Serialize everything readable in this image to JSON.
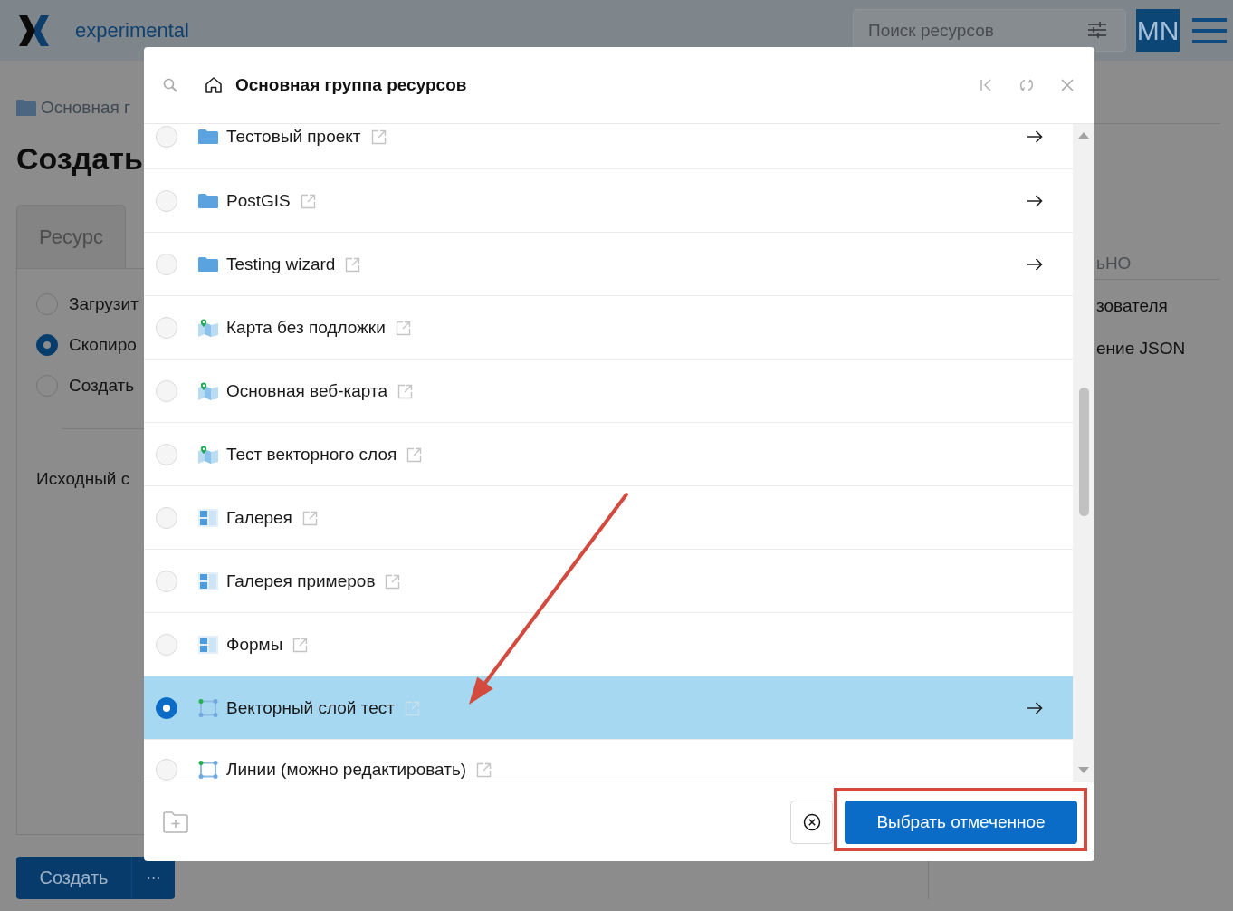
{
  "header": {
    "brand": "experimental",
    "search": {
      "placeholder": "Поиск ресурсов"
    },
    "avatar": "MN"
  },
  "page": {
    "breadcrumb": "Основная г",
    "title": "Создать",
    "tabs": [
      {
        "label": "Ресурс",
        "selected": false
      }
    ],
    "options": [
      {
        "label": "Загрузит",
        "selected": false
      },
      {
        "label": "Скопиро",
        "selected": true
      },
      {
        "label": "Создать",
        "selected": false
      }
    ],
    "source_label": "Исходный с",
    "buttons": {
      "create": "Создать",
      "more": "⋯"
    },
    "side": {
      "section": "ьНО",
      "items": [
        "зователя",
        "ение JSON"
      ]
    }
  },
  "dialog": {
    "title": "Основная группа ресурсов",
    "items": [
      {
        "kind": "folder",
        "name": "Тестовый проект",
        "openable": true,
        "selected": false,
        "annotated": false
      },
      {
        "kind": "folder",
        "name": "PostGIS",
        "openable": true,
        "selected": false,
        "annotated": false
      },
      {
        "kind": "folder",
        "name": "Testing wizard",
        "openable": true,
        "selected": false,
        "annotated": false
      },
      {
        "kind": "map",
        "name": "Карта без подложки",
        "openable": false,
        "selected": false,
        "annotated": false
      },
      {
        "kind": "map",
        "name": "Основная веб-карта",
        "openable": false,
        "selected": false,
        "annotated": false
      },
      {
        "kind": "map",
        "name": "Тест векторного слоя",
        "openable": false,
        "selected": false,
        "annotated": false
      },
      {
        "kind": "tiles",
        "name": "Галерея",
        "openable": false,
        "selected": false,
        "annotated": false
      },
      {
        "kind": "tiles",
        "name": "Галерея примеров",
        "openable": false,
        "selected": false,
        "annotated": false
      },
      {
        "kind": "tiles",
        "name": "Формы",
        "openable": false,
        "selected": false,
        "annotated": false
      },
      {
        "kind": "vector",
        "name": "Векторный слой тест",
        "openable": true,
        "selected": true,
        "annotated": true
      },
      {
        "kind": "vector",
        "name": "Линии (можно редактировать)",
        "openable": false,
        "selected": false,
        "annotated": false
      }
    ],
    "submit": {
      "label": "Выбрать отмеченное",
      "annotated": true
    }
  }
}
